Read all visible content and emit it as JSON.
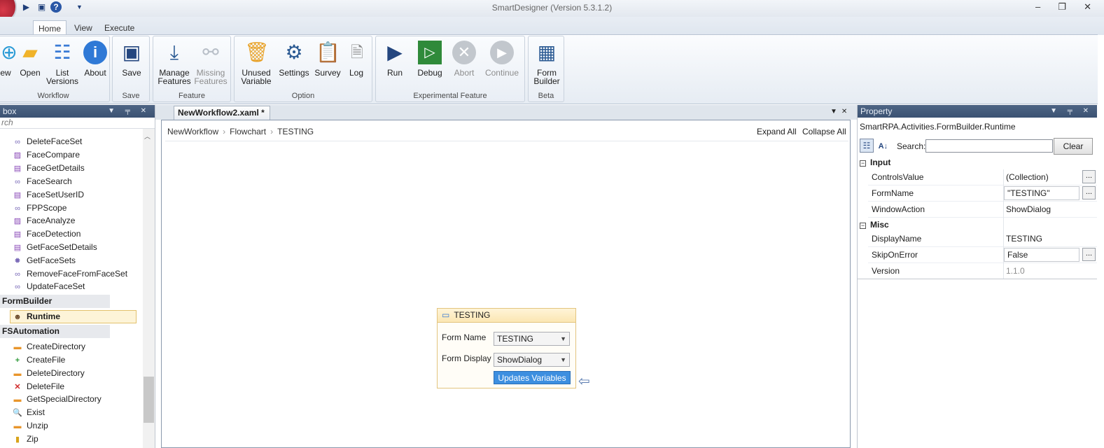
{
  "app": {
    "title": "SmartDesigner (Version 5.3.1.2)"
  },
  "window_controls": [
    "–",
    "❐",
    "✕"
  ],
  "menu_tabs": [
    {
      "label": "Home",
      "active": true
    },
    {
      "label": "View"
    },
    {
      "label": "Execute"
    }
  ],
  "ribbon": {
    "groups": [
      {
        "label": "Workflow",
        "buttons": [
          {
            "label": "ew"
          },
          {
            "label": "Open"
          },
          {
            "label": "List\nVersions"
          },
          {
            "label": "About"
          }
        ]
      },
      {
        "label": "Save",
        "buttons": [
          {
            "label": "Save"
          }
        ]
      },
      {
        "label": "Feature",
        "buttons": [
          {
            "label": "Manage\nFeatures"
          },
          {
            "label": "Missing\nFeatures",
            "disabled": true
          }
        ]
      },
      {
        "label": "Option",
        "buttons": [
          {
            "label": "Unused\nVariable"
          },
          {
            "label": "Settings"
          },
          {
            "label": "Survey"
          },
          {
            "label": "Log"
          }
        ]
      },
      {
        "label": "Experimental Feature",
        "buttons": [
          {
            "label": "Run"
          },
          {
            "label": "Debug"
          },
          {
            "label": "Abort",
            "disabled": true
          },
          {
            "label": "Continue",
            "disabled": true
          }
        ]
      },
      {
        "label": "Beta",
        "buttons": [
          {
            "label": "Form\nBuilder"
          }
        ]
      }
    ]
  },
  "toolbox": {
    "title": "box",
    "search_placeholder": "rch",
    "items_top": [
      "DeleteFaceSet",
      "FaceCompare",
      "FaceGetDetails",
      "FaceSearch",
      "FaceSetUserID",
      "FPPScope",
      "FaceAnalyze",
      "FaceDetection",
      "GetFaceSetDetails",
      "GetFaceSets",
      "RemoveFaceFromFaceSet",
      "UpdateFaceSet"
    ],
    "category1": "FormBuilder",
    "selected_item": "Runtime",
    "category2": "FSAutomation",
    "items_bottom": [
      "CreateDirectory",
      "CreateFile",
      "DeleteDirectory",
      "DeleteFile",
      "GetSpecialDirectory",
      "Exist",
      "Unzip",
      "Zip"
    ]
  },
  "document": {
    "tab_label": "NewWorkflow2.xaml *",
    "breadcrumb": [
      "NewWorkflow",
      "Flowchart",
      "TESTING"
    ],
    "expand_all": "Expand All",
    "collapse_all": "Collapse All"
  },
  "activity": {
    "title": "TESTING",
    "form_name_label": "Form Name",
    "form_name_value": "TESTING",
    "form_display_label": "Form Display",
    "form_display_value": "ShowDialog",
    "updates_button": "Updates Variables"
  },
  "properties": {
    "title": "Property",
    "type_name": "SmartRPA.Activities.FormBuilder.Runtime",
    "search_label": "Search:",
    "clear_label": "Clear",
    "input_category": "Input",
    "misc_category": "Misc",
    "rows": [
      {
        "name": "ControlsValue",
        "value": "(Collection)"
      },
      {
        "name": "FormName",
        "value": "\"TESTING\""
      },
      {
        "name": "WindowAction",
        "value": "ShowDialog"
      },
      {
        "name": "DisplayName",
        "value": "TESTING"
      },
      {
        "name": "SkipOnError",
        "value": "False"
      },
      {
        "name": "Version",
        "value": "1.1.0"
      }
    ]
  }
}
